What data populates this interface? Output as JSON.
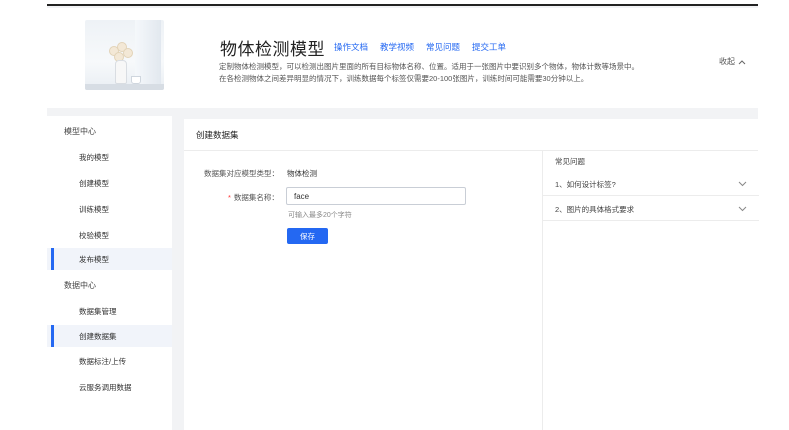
{
  "header": {
    "title": "物体检测模型",
    "links": [
      "操作文档",
      "教学视频",
      "常见问题",
      "提交工单"
    ],
    "desc_line1": "定制物体检测模型，可以检测出图片里面的所有目标物体名称、位置。适用于一张图片中要识别多个物体，物体计数等场景中。",
    "desc_line2": "在各检测物体之间差异明显的情况下，训练数据每个标签仅需要20-100张图片，训练时间可能需要30分钟以上。",
    "collapse_label": "收起",
    "collapse_icon": "chevron-up-icon"
  },
  "sidebar": {
    "group1": "模型中心",
    "group1_items": [
      {
        "label": "我的模型",
        "active": false
      },
      {
        "label": "创建模型",
        "active": false
      },
      {
        "label": "训练模型",
        "active": false
      },
      {
        "label": "校验模型",
        "active": false
      },
      {
        "label": "发布模型",
        "active": true
      }
    ],
    "group2": "数据中心",
    "group2_items": [
      {
        "label": "数据集管理",
        "active": false
      },
      {
        "label": "创建数据集",
        "active": true
      },
      {
        "label": "数据标注/上传",
        "active": false
      },
      {
        "label": "云服务调用数据",
        "active": false
      }
    ]
  },
  "main": {
    "title": "创建数据集",
    "model_type_label": "数据集对应模型类型：",
    "model_type_value": "物体检测",
    "name_label": "数据集名称：",
    "name_required": "*",
    "name_value": "face",
    "name_hint": "可输入最多20个字符",
    "save_label": "保存"
  },
  "faq": {
    "title": "常见问题",
    "items": [
      "1、如何设计标签?",
      "2、图片的具体格式要求"
    ]
  },
  "colors": {
    "accent": "#2468f2",
    "background": "#f2f3f5"
  }
}
